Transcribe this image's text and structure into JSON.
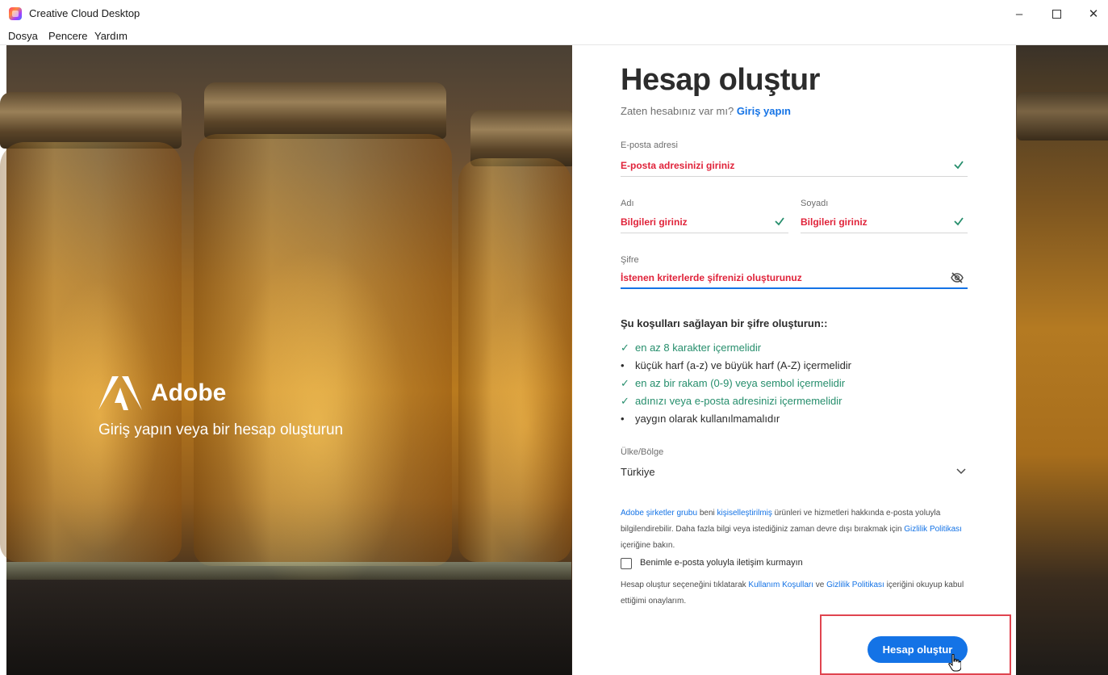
{
  "window": {
    "title": "Creative Cloud Desktop",
    "minimize": "–",
    "close": "✕"
  },
  "menu": [
    "Dosya",
    "Pencere",
    "Yardım"
  ],
  "brand": {
    "name": "Adobe",
    "tagline": "Giriş yapın veya bir hesap oluşturun"
  },
  "form": {
    "title": "Hesap oluştur",
    "subtitle_prefix": "Zaten hesabınız var mı?",
    "signin_link": "Giriş yapın",
    "email": {
      "label": "E-posta adresi",
      "value": "E-posta adresinizi giriniz"
    },
    "first_name": {
      "label": "Adı",
      "value": "Bilgileri giriniz"
    },
    "last_name": {
      "label": "Soyadı",
      "value": "Bilgileri giriniz"
    },
    "password": {
      "label": "Şifre",
      "value": "İstenen kriterlerde şifrenizi oluşturunuz"
    },
    "rules_title": "Şu koşulları sağlayan bir şifre oluşturun::",
    "rules": [
      {
        "text": "en az 8 karakter içermelidir",
        "status": "ok"
      },
      {
        "text": "küçük harf (a-z) ve büyük harf (A-Z) içermelidir",
        "status": "pending"
      },
      {
        "text": "en az bir rakam (0-9) veya sembol içermelidir",
        "status": "ok"
      },
      {
        "text": "adınızı veya e-posta adresinizi içermemelidir",
        "status": "ok"
      },
      {
        "text": "yaygın olarak kullanılmamalıdır",
        "status": "pending"
      }
    ],
    "country": {
      "label": "Ülke/Bölge",
      "value": "Türkiye"
    },
    "notice": {
      "link1": "Adobe şirketler grubu",
      "text1": " beni ",
      "link2": "kişiselleştirilmiş",
      "text2": " ürünleri ve hizmetleri hakkında e-posta yoluyla bilgilendirebilir. Daha fazla bilgi veya istediğiniz zaman devre dışı bırakmak için ",
      "link3": "Gizlilik Politikası",
      "text3": " içeriğine bakın."
    },
    "optout_label": "Benimle e-posta yoluyla iletişim kurmayın",
    "terms": {
      "text1": "Hesap oluştur seçeneğini tıklatarak ",
      "link1": "Kullanım Koşulları",
      "text2": " ve ",
      "link2": "Gizlilik Politikası",
      "text3": " içeriğini okuyup kabul ettiğimi onaylarım."
    },
    "submit_label": "Hesap oluştur"
  },
  "colors": {
    "accent": "#1473e6",
    "error_text": "#e0233a",
    "success": "#268e6c",
    "highlight_box": "#e0444f"
  },
  "icons": {
    "app": "creative-cloud-icon",
    "check": "check-icon",
    "eye": "eye-slash-icon",
    "chevron": "chevron-down-icon",
    "cursor": "hand-cursor-icon"
  }
}
